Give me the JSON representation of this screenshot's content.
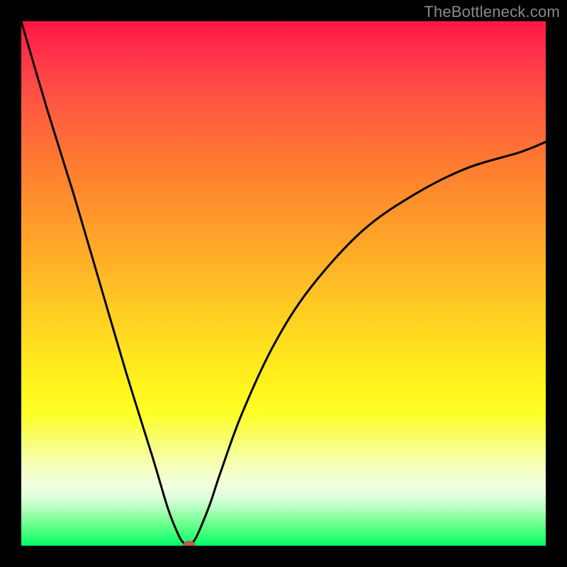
{
  "watermark": "TheBottleneck.com",
  "chart_data": {
    "type": "line",
    "title": "",
    "xlabel": "",
    "ylabel": "",
    "xlim": [
      0,
      100
    ],
    "ylim": [
      0,
      100
    ],
    "grid": false,
    "legend": false,
    "background_gradient": {
      "stops": [
        {
          "pos": 0,
          "color": "#ff1744"
        },
        {
          "pos": 50,
          "color": "#ffbd25"
        },
        {
          "pos": 75,
          "color": "#fcff28"
        },
        {
          "pos": 95,
          "color": "#80ff9a"
        },
        {
          "pos": 100,
          "color": "#00f56a"
        }
      ]
    },
    "series": [
      {
        "name": "bottleneck-curve",
        "x": [
          0,
          5,
          10,
          15,
          20,
          25,
          28,
          30,
          31,
          32,
          33,
          34,
          36,
          38,
          42,
          48,
          55,
          65,
          75,
          85,
          95,
          100
        ],
        "y": [
          100,
          83,
          67,
          50,
          33,
          17,
          7,
          2,
          0.5,
          0,
          1,
          3,
          8,
          14,
          25,
          38,
          49,
          60,
          67,
          72,
          75,
          77
        ]
      }
    ],
    "markers": [
      {
        "name": "optimal-point",
        "x": 32,
        "y": 0,
        "color": "#c05a4a"
      }
    ]
  }
}
